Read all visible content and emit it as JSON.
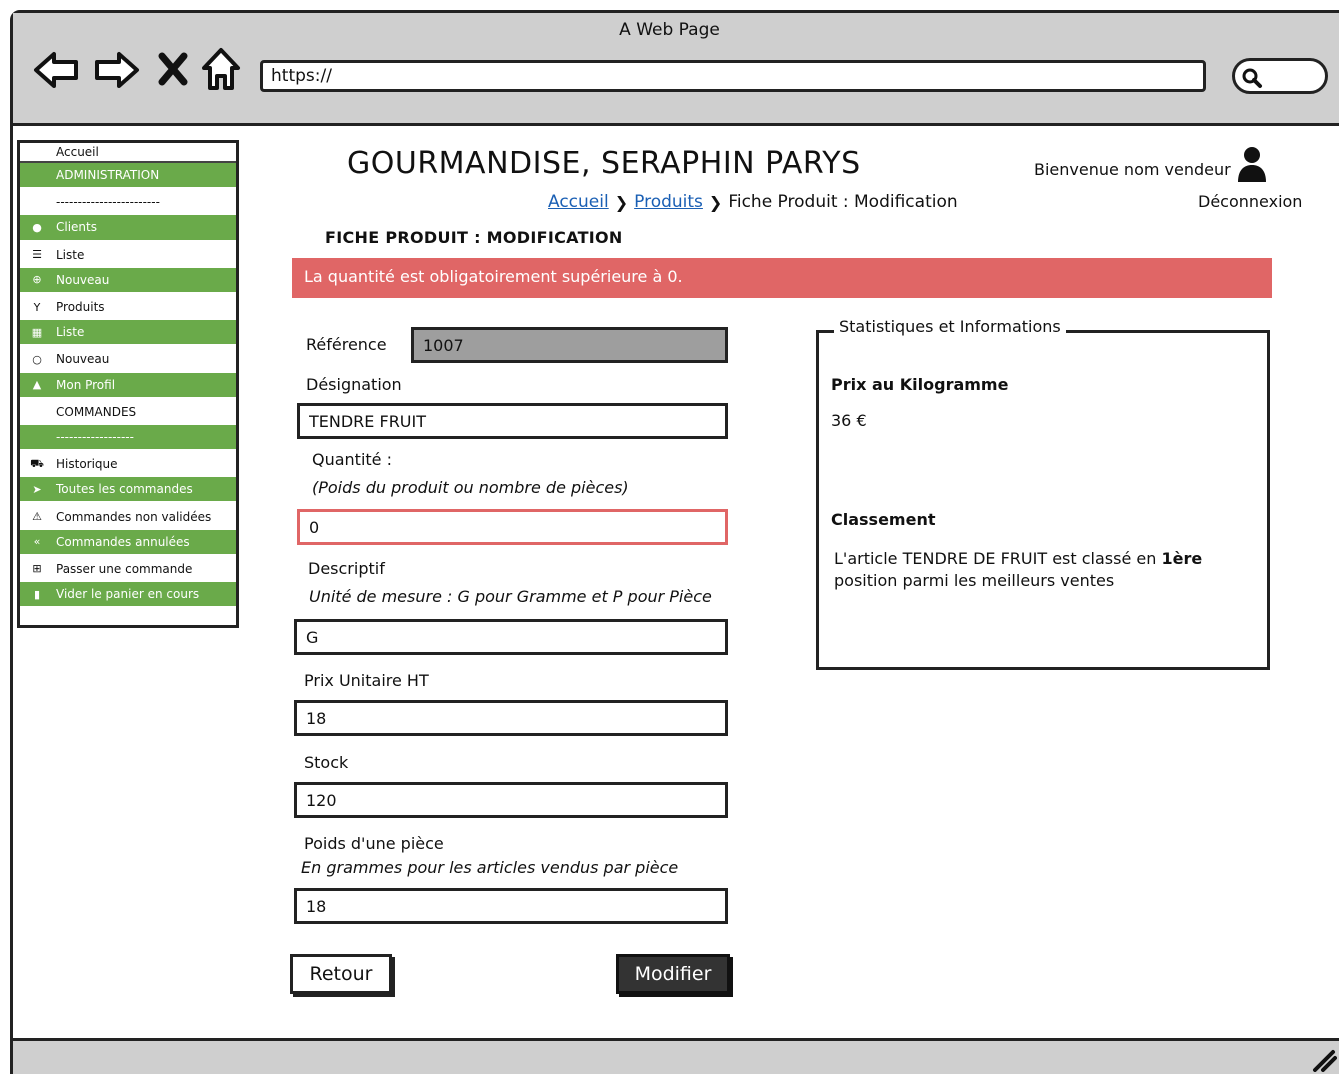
{
  "window": {
    "title": "A Web Page",
    "url": "https://"
  },
  "sidebar": {
    "header": "Accueil",
    "items": [
      {
        "label": "ADMINISTRATION",
        "icon": "",
        "style": "green"
      },
      {
        "label": "------------------------",
        "icon": "",
        "style": "white"
      },
      {
        "label": "Clients",
        "icon": "clients-icon",
        "style": "green"
      },
      {
        "label": "Liste",
        "icon": "list-icon",
        "style": "white"
      },
      {
        "label": "Nouveau",
        "icon": "plus-circle-icon",
        "style": "green"
      },
      {
        "label": "Produits",
        "icon": "glass-icon",
        "style": "white"
      },
      {
        "label": "Liste",
        "icon": "grid-list-icon",
        "style": "green"
      },
      {
        "label": "Nouveau",
        "icon": "circle-icon",
        "style": "white"
      },
      {
        "label": "Mon Profil",
        "icon": "user-icon",
        "style": "green"
      },
      {
        "label": "COMMANDES",
        "icon": "",
        "style": "white"
      },
      {
        "label": "------------------",
        "icon": "",
        "style": "green"
      },
      {
        "label": "Historique",
        "icon": "cart-icon",
        "style": "white"
      },
      {
        "label": "Toutes les commandes",
        "icon": "send-icon",
        "style": "green"
      },
      {
        "label": "Commandes non validées",
        "icon": "warning-icon",
        "style": "white"
      },
      {
        "label": "Commandes annulées",
        "icon": "double-chevron-left-icon",
        "style": "green"
      },
      {
        "label": "Passer une commande",
        "icon": "plus-square-icon",
        "style": "white"
      },
      {
        "label": "Vider le panier en cours",
        "icon": "trash-icon",
        "style": "green"
      }
    ]
  },
  "header": {
    "brand": "GOURMANDISE, SERAPHIN PARYS",
    "welcome": "Bienvenue nom vendeur",
    "logout": "Déconnexion"
  },
  "breadcrumb": {
    "home": "Accueil",
    "products": "Produits",
    "current": "Fiche Produit : Modification"
  },
  "page": {
    "title": "FICHE PRODUIT : MODIFICATION",
    "alert": "La quantité est obligatoirement supérieure à 0.",
    "colors": {
      "alert": "#e06666",
      "menu_green": "#6aaa4a"
    }
  },
  "form": {
    "reference": {
      "label": "Référence",
      "value": "1007"
    },
    "designation": {
      "label": "Désignation",
      "value": "TENDRE FRUIT"
    },
    "quantite": {
      "label": "Quantité :",
      "hint": "(Poids du produit ou nombre de pièces)",
      "value": "0"
    },
    "descriptif": {
      "label": "Descriptif",
      "hint": "Unité de mesure : G pour Gramme et P pour  Pièce",
      "value": "G"
    },
    "prix": {
      "label": "Prix Unitaire HT",
      "value": "18"
    },
    "stock": {
      "label": "Stock",
      "value": "120"
    },
    "poids": {
      "label": "Poids d'une pièce",
      "hint": "En grammes pour les articles vendus par pièce",
      "value": "18"
    },
    "retour_label": "Retour",
    "modifier_label": "Modifier"
  },
  "stats": {
    "legend": "Statistiques et Informations",
    "prix_kg_label": "Prix au Kilogramme",
    "prix_kg_value": "36 €",
    "classement_label": "Classement",
    "classement_text_1": "L'article TENDRE DE FRUIT est classé en ",
    "classement_rank": "1ère",
    "classement_text_2": "position parmi les meilleurs ventes"
  }
}
